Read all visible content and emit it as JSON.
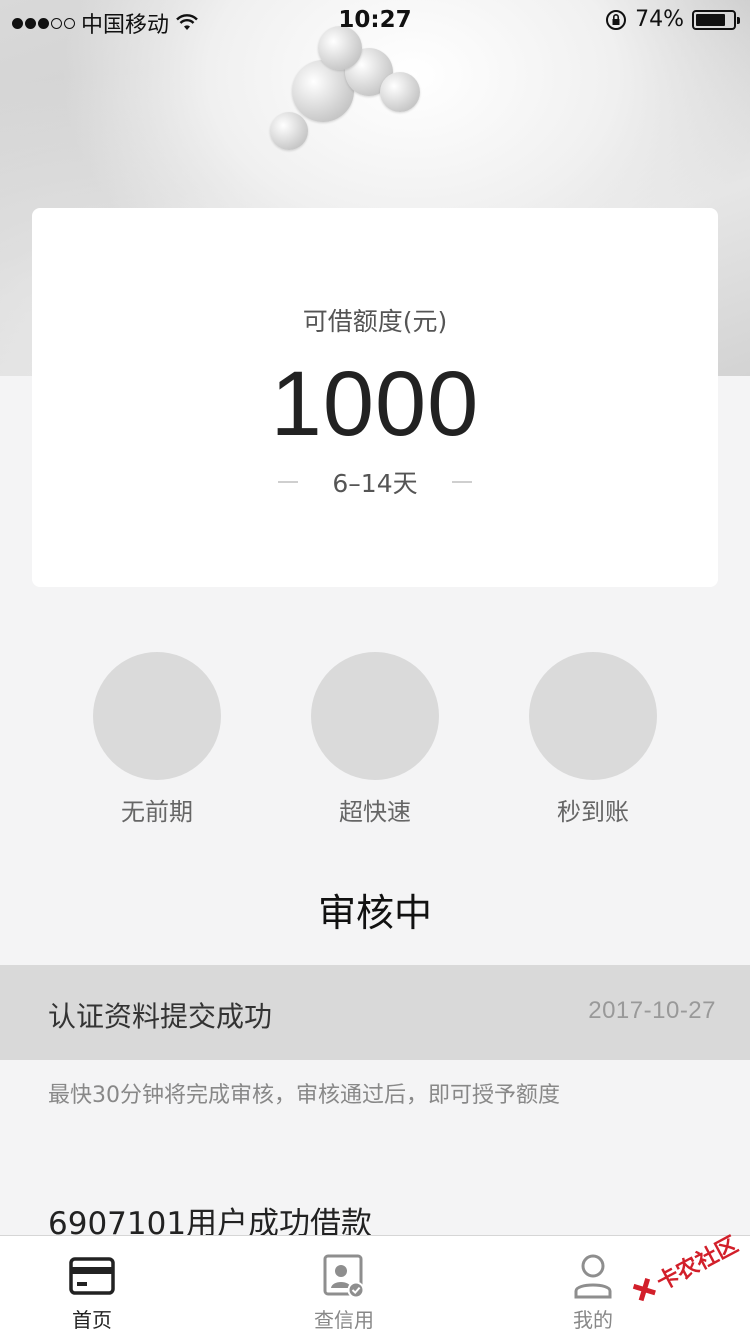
{
  "status_bar": {
    "carrier": "中国移动",
    "time": "10:27",
    "battery_pct": "74%"
  },
  "loan_card": {
    "label": "可借额度(元)",
    "amount": "1000",
    "term": "6–14天"
  },
  "features": [
    {
      "label": "无前期"
    },
    {
      "label": "超快速"
    },
    {
      "label": "秒到账"
    }
  ],
  "review": {
    "title": "审核中",
    "step_text": "认证资料提交成功",
    "step_date": "2017-10-27",
    "note": "最快30分钟将完成审核，审核通过后，即可授予额度"
  },
  "ticker": {
    "text": "6907101用户成功借款"
  },
  "tab_bar": {
    "tabs": [
      {
        "label": "首页",
        "icon": "card-icon",
        "active": true
      },
      {
        "label": "查信用",
        "icon": "credit-profile-icon",
        "active": false
      },
      {
        "label": "我的",
        "icon": "user-icon",
        "active": false
      }
    ]
  },
  "watermark": {
    "text": "卡农社区"
  },
  "colors": {
    "page_bg": "#f4f4f5",
    "card_bg": "#ffffff",
    "feature_circle": "#dadada",
    "audit_row_bg": "#d9d9d9",
    "watermark_red": "#d21f2a"
  }
}
